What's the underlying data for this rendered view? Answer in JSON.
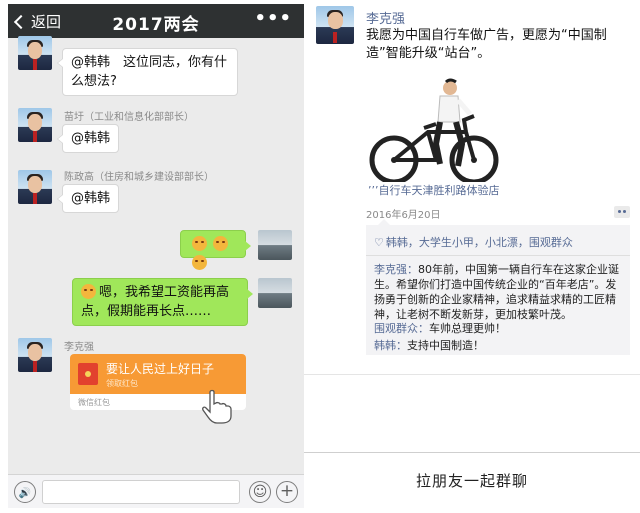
{
  "chat": {
    "back_label": "返回",
    "title": "2017两会",
    "more_label": "•••",
    "messages": [
      {
        "sender": "",
        "text_line1": "@韩韩　这位同志，你有什",
        "text_line2": "么想法?"
      },
      {
        "sender": "苗圩（工业和信息化部部长）",
        "text": "@韩韩"
      },
      {
        "sender": "陈政高（住房和城乡建设部部长）",
        "text": "@韩韩"
      },
      {
        "emojis": [
          "😣",
          "😣",
          "😣"
        ]
      },
      {
        "text_line1": "嗯，我希望工资能再高",
        "text_line2": "点，假期能再长点……"
      },
      {
        "sender": "李克强"
      }
    ],
    "red_packet": {
      "title": "要让人民过上好日子",
      "subtitle": "领取红包",
      "footer": "微信红包"
    },
    "input_bar": {
      "voice_icon": "🔊",
      "emoji_icon": "☺",
      "plus_icon": "+"
    }
  },
  "moment": {
    "author": "李克强",
    "text_line1": "我愿为中国自行车做广告，更愿为“中国制",
    "text_line2": "造”智能升级“站台”。",
    "location": "’’’自行车天津胜利路体验店",
    "date": "2016年6月20日",
    "likes": "韩韩，大学生小甲，小北漂，围观群众",
    "comments": [
      {
        "name": "李克强：",
        "text": "80年前，中国第一辆自行车在这家企业诞生。希望你们打造中国传统企业的“百年老店”。发扬勇于创新的企业家精神，追求精益求精的工匠精神，让老树不断发新芽，更加枝繁叶茂。"
      },
      {
        "name": "围观群众：",
        "text": "车帅总理更帅！"
      },
      {
        "name": "韩韩：",
        "text": "支持中国制造！"
      }
    ]
  },
  "footer": {
    "pull_friends": "拉朋友一起群聊"
  },
  "colors": {
    "header_bg": "#2e3132",
    "bubble_green": "#a0e75a",
    "link_blue": "#576b95",
    "red_packet": "#f79a35"
  }
}
